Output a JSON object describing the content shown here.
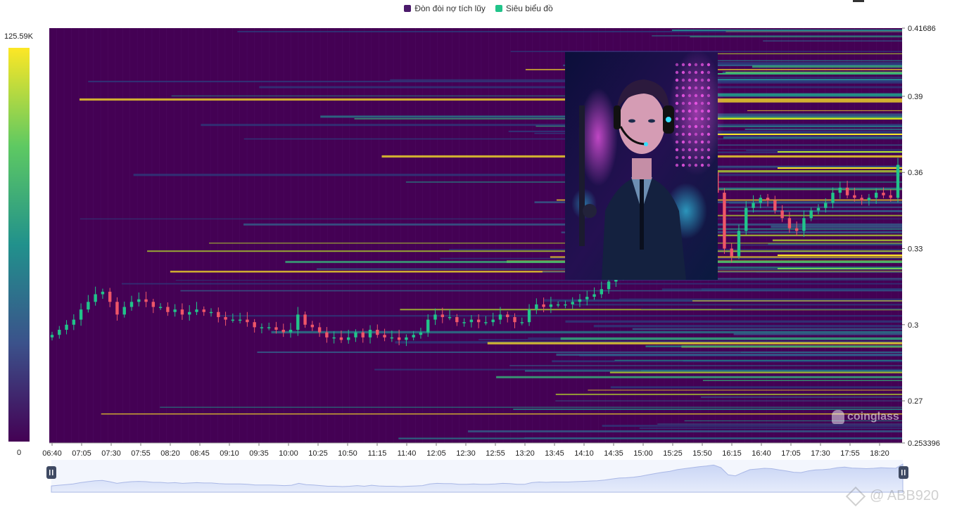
{
  "legend": {
    "items": [
      {
        "label": "Đòn đòi nợ tích lũy",
        "color": "#4b1a6b"
      },
      {
        "label": "Siêu biểu đồ",
        "color": "#21c48a"
      }
    ]
  },
  "colorbar": {
    "max_label": "125.59K",
    "min_label": "0",
    "gradient": [
      "#440154",
      "#3b528b",
      "#21918c",
      "#5ec962",
      "#fde725"
    ]
  },
  "brand_label": "coinglass",
  "watermark_label": "@ ABB920",
  "icons": {
    "brand": "coinglass-logo-icon",
    "watermark": "binance-logo-icon"
  },
  "colors": {
    "background": "#440154",
    "up": "#21c48a",
    "down": "#ef5668",
    "navigator_fill": "#d6e0f7",
    "navigator_line": "#aab8e6"
  },
  "chart_data": {
    "type": "heatmap",
    "xlabel": "",
    "ylabel": "",
    "x_ticks": [
      "06:40",
      "07:05",
      "07:30",
      "07:55",
      "08:20",
      "08:45",
      "09:10",
      "09:35",
      "10:00",
      "10:25",
      "10:50",
      "11:15",
      "11:40",
      "12:05",
      "12:30",
      "12:55",
      "13:20",
      "13:45",
      "14:10",
      "14:35",
      "15:00",
      "15:25",
      "15:50",
      "16:15",
      "16:40",
      "17:05",
      "17:30",
      "17:55",
      "18:20"
    ],
    "y_ticks": [
      "0.41686",
      "0.39",
      "0.36",
      "0.33",
      "0.3",
      "0.27",
      "0.253396"
    ],
    "ylim": [
      0.253396,
      0.41686
    ],
    "price_candles_close": [
      0.296,
      0.298,
      0.3,
      0.302,
      0.306,
      0.309,
      0.312,
      0.313,
      0.309,
      0.304,
      0.307,
      0.309,
      0.31,
      0.309,
      0.307,
      0.307,
      0.305,
      0.306,
      0.304,
      0.305,
      0.306,
      0.305,
      0.305,
      0.303,
      0.302,
      0.302,
      0.302,
      0.301,
      0.299,
      0.299,
      0.299,
      0.298,
      0.297,
      0.298,
      0.304,
      0.3,
      0.299,
      0.297,
      0.295,
      0.295,
      0.294,
      0.295,
      0.297,
      0.295,
      0.298,
      0.296,
      0.295,
      0.295,
      0.294,
      0.295,
      0.296,
      0.297,
      0.302,
      0.304,
      0.303,
      0.303,
      0.301,
      0.301,
      0.302,
      0.301,
      0.301,
      0.302,
      0.304,
      0.303,
      0.301,
      0.301,
      0.306,
      0.308,
      0.307,
      0.308,
      0.308,
      0.308,
      0.309,
      0.31,
      0.311,
      0.312,
      0.314,
      0.317,
      0.32,
      0.321,
      0.323,
      0.326,
      0.33,
      0.334,
      0.338,
      0.341,
      0.346,
      0.349,
      0.352,
      0.355,
      0.357,
      0.36,
      0.352,
      0.33,
      0.327,
      0.337,
      0.346,
      0.348,
      0.35,
      0.349,
      0.345,
      0.342,
      0.338,
      0.337,
      0.342,
      0.345,
      0.346,
      0.348,
      0.352,
      0.354,
      0.351,
      0.35,
      0.349,
      0.35,
      0.352,
      0.351,
      0.35,
      0.363
    ]
  },
  "navigator": {
    "handles": [
      "navigator-left-handle",
      "navigator-right-handle"
    ]
  }
}
